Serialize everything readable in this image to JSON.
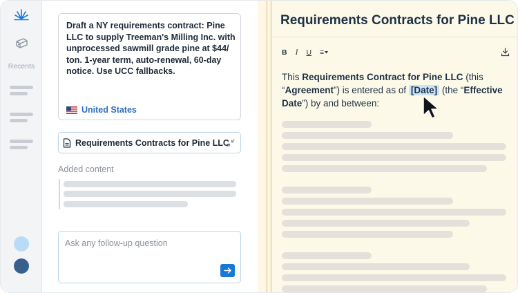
{
  "prompt": {
    "text": "Draft a NY requirements contract: Pine LLC to supply Treeman's Milling Inc. with unprocessed sawmill grade pine at $44/ ton. 1-year term, auto-renewal, 60-day notice. Use UCC fallbacks.",
    "country": "United States"
  },
  "rail": {
    "recents_label": "Recents"
  },
  "document_chip": {
    "label": "Requirements Contracts for Pine LLC"
  },
  "added_content": {
    "label": "Added content"
  },
  "followup": {
    "placeholder": "Ask any follow-up question"
  },
  "document": {
    "title": "Requirements Contracts for Pine LLC",
    "toolbar": {
      "bold": "B",
      "italic": "I",
      "underline": "U",
      "align": "≡"
    },
    "intro": {
      "t1": "This ",
      "contract_name": "Requirements Contract for Pine LLC",
      "t2": " (this “",
      "agreement": "Agreement",
      "t3": "”) is entered as of ",
      "date_tag": "[Date]",
      "t4": " (the “",
      "effective_date": "Effective Date",
      "t5": "”) by and between:"
    }
  },
  "colors": {
    "accent": "#1679d8",
    "link": "#2f6fc0",
    "doc_background": "#fdf9e8",
    "rail_background": "#f3f4f6",
    "divider_line": "#e2b784",
    "avatar_light": "#b8dcf7",
    "avatar_dark": "#37608f"
  }
}
